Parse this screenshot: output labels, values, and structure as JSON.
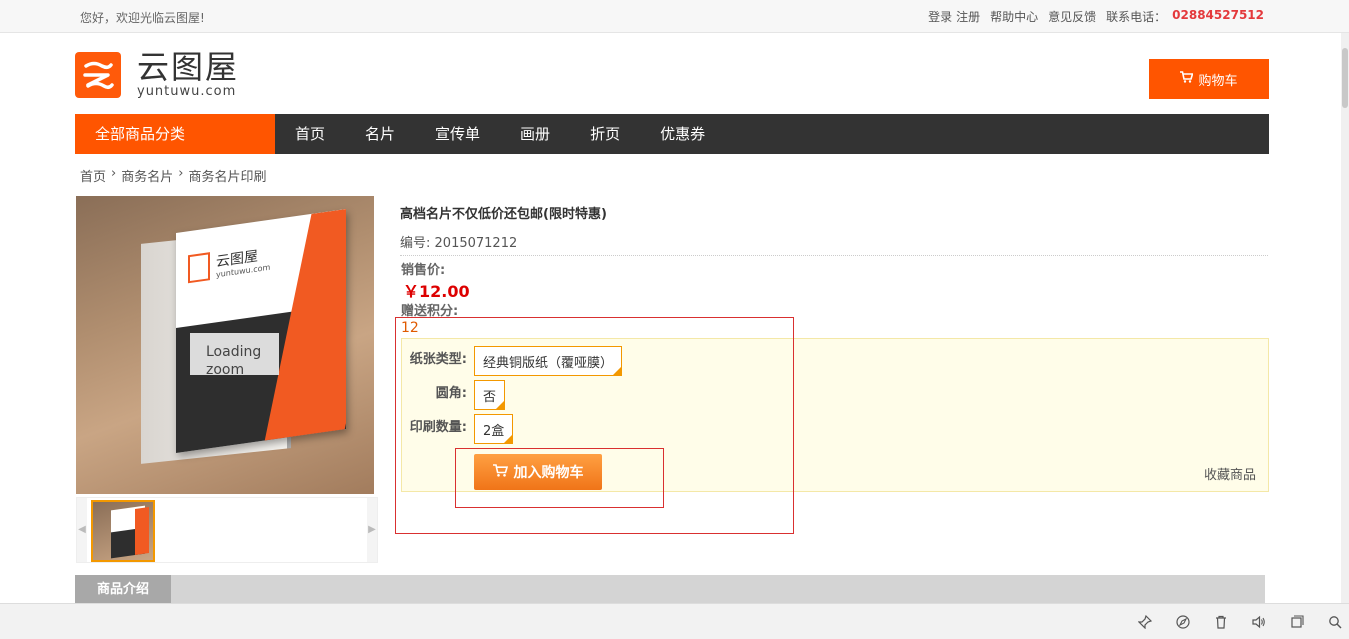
{
  "topbar": {
    "welcome": "您好，欢迎光临云图屋!",
    "login": "登录",
    "register": "注册",
    "help": "帮助中心",
    "feedback": "意见反馈",
    "phone_label": "联系电话：",
    "phone": "02884527512"
  },
  "header": {
    "logo_cn": "云图屋",
    "logo_en": "yuntuwu.com",
    "cart_label": "购物车"
  },
  "nav": {
    "all_categories": "全部商品分类",
    "items": [
      "首页",
      "名片",
      "宣传单",
      "画册",
      "折页",
      "优惠券"
    ]
  },
  "breadcrumb": [
    "首页",
    "商务名片",
    "商务名片印刷"
  ],
  "product": {
    "loading_text": "Loading zoom",
    "card_name": "云图屋",
    "card_url": "yuntuwu.com",
    "title": "高档名片不仅低价还包邮(限时特惠)",
    "code_label": "编号:",
    "code": "2015071212",
    "price_label": "销售价:",
    "price": "￥12.00",
    "points_label": "赠送积分:",
    "points": "12",
    "options": {
      "paper_label": "纸张类型:",
      "paper_value": "经典铜版纸（覆哑膜）",
      "corner_label": "圆角:",
      "corner_value": "否",
      "qty_label": "印刷数量:",
      "qty_value": "2盒"
    },
    "add_to_cart": "加入购物车",
    "favorite": "收藏商品"
  },
  "tabs": {
    "intro": "商品介绍"
  },
  "colors": {
    "brand": "#ff5500",
    "nav_bg": "#333333",
    "price": "#dd0000",
    "option_bg": "#fffde9"
  }
}
